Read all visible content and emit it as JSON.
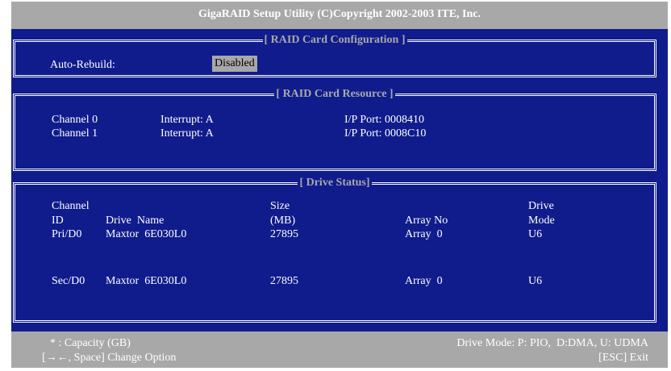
{
  "title": "GigaRAID Setup Utility (C)Copyright 2002-2003 ITE, Inc.",
  "config": {
    "heading": "[ RAID Card Configuration ]",
    "auto_rebuild_label": "Auto-Rebuild:",
    "auto_rebuild_value": "Disabled"
  },
  "resource": {
    "heading": "[ RAID Card Resource ]",
    "rows": [
      {
        "channel": "Channel 0",
        "interrupt": "Interrupt: A",
        "io_port": "I/P Port: 0008410"
      },
      {
        "channel": "Channel 1",
        "interrupt": "Interrupt: A",
        "io_port": "I/P Port: 0008C10"
      }
    ]
  },
  "drives": {
    "heading": "[ Drive Status]",
    "headers": {
      "channel_1": "Channel",
      "channel_2": "ID",
      "name": "Drive  Name",
      "size_1": "Size",
      "size_2": "(MB)",
      "array": "Array No",
      "mode_1": "Drive",
      "mode_2": "Mode"
    },
    "rows": [
      {
        "id": "Pri/D0",
        "name": "Maxtor  6E030L0",
        "size": "27895",
        "array": "Array  0",
        "mode": "U6"
      },
      {
        "id": "Sec/D0",
        "name": "Maxtor  6E030L0",
        "size": "27895",
        "array": "Array  0",
        "mode": "U6"
      }
    ]
  },
  "footer": {
    "capacity_note": "* : Capacity (GB)",
    "drive_mode_legend": "Drive Mode: P: PIO,  D:DMA, U: UDMA",
    "change_option": "[→←, Space] Change Option",
    "exit": "[ESC] Exit"
  },
  "colors": {
    "background": "#101c8c",
    "bar": "#a8a8a8",
    "text": "#ffffff",
    "heading": "#a8a8a8"
  }
}
